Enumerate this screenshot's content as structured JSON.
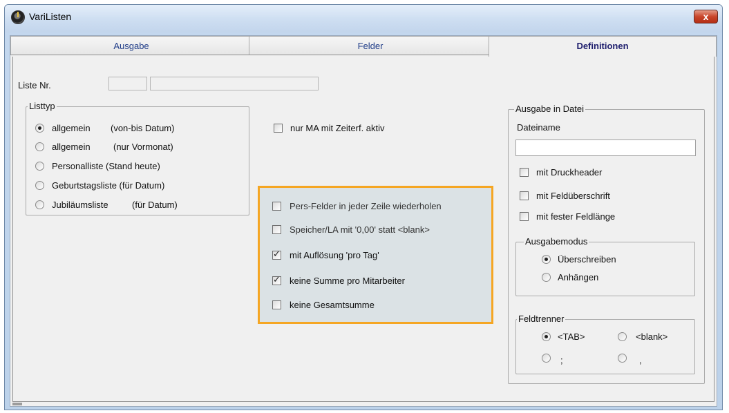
{
  "window": {
    "title": "VariListen",
    "close_label": "x"
  },
  "tabs": [
    {
      "label": "Ausgabe"
    },
    {
      "label": "Felder"
    },
    {
      "label": "Definitionen",
      "active": true
    }
  ],
  "liste": {
    "label": "Liste Nr.",
    "number_value": "",
    "name_value": ""
  },
  "listtyp": {
    "legend": "Listtyp",
    "options": [
      {
        "label": "allgemein",
        "hint": "(von-bis Datum)",
        "selected": true
      },
      {
        "label": "allgemein",
        "hint": "(nur Vormonat)",
        "selected": false
      },
      {
        "label": "Personalliste  (Stand heute)",
        "selected": false
      },
      {
        "label": "Geburtstagsliste (für Datum)",
        "selected": false
      },
      {
        "label": "Jubiläumsliste",
        "hint": "(für Datum)",
        "selected": false
      }
    ]
  },
  "nur_ma": {
    "label": "nur MA mit Zeiterf. aktiv",
    "checked": false
  },
  "options": [
    {
      "label": "Pers-Felder in jeder Zeile wiederholen",
      "checked": false
    },
    {
      "label": "Speicher/LA mit '0,00' statt <blank>",
      "checked": false
    },
    {
      "label": "mit Auflösung 'pro Tag'",
      "checked": true
    },
    {
      "label": "keine Summe pro Mitarbeiter",
      "checked": true
    },
    {
      "label": "keine Gesamtsumme",
      "checked": false
    }
  ],
  "highlight_color": "#f5a623",
  "ausgabe_datei": {
    "legend": "Ausgabe in Datei",
    "dateiname_label": "Dateiname",
    "dateiname_value": "",
    "checks": [
      {
        "label": "mit Druckheader",
        "checked": false
      },
      {
        "label": "mit Feldüberschrift",
        "checked": false
      },
      {
        "label": "mit fester Feldlänge",
        "checked": false
      }
    ],
    "ausgabemodus": {
      "legend": "Ausgabemodus",
      "options": [
        {
          "label": "Überschreiben",
          "selected": true
        },
        {
          "label": "Anhängen",
          "selected": false
        }
      ]
    },
    "feldtrenner": {
      "legend": "Feldtrenner",
      "options": [
        {
          "label": "<TAB>",
          "selected": true
        },
        {
          "label": "<blank>",
          "selected": false
        },
        {
          "label": ";",
          "selected": false
        },
        {
          "label": ",",
          "selected": false
        }
      ]
    }
  }
}
